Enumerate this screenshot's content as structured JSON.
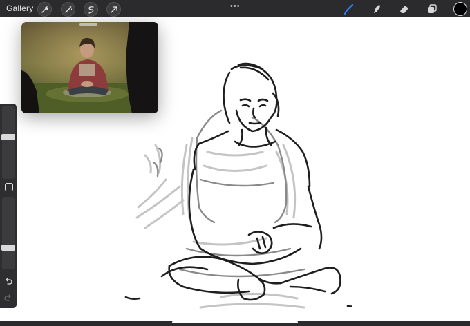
{
  "app": {
    "gallery_label": "Gallery"
  },
  "toolbar": {
    "left_tools": [
      "wrench-icon",
      "magic-wand-icon",
      "selection-icon",
      "transform-arrow-icon"
    ],
    "more": "•••",
    "right_tools": [
      "brush-icon",
      "smudge-icon",
      "eraser-icon",
      "layers-icon"
    ],
    "active_tool": "brush-icon",
    "accent_color": "#2f7cf6",
    "current_color": "#000000"
  },
  "sidebar": {
    "brush_size": 0.58,
    "opacity": 0.28,
    "modify_button": "square-icon",
    "undo": "undo-icon",
    "redo": "redo-icon"
  },
  "reference": {
    "image": "reference-photo-girl-sitting-on-grass"
  },
  "canvas": {
    "background": "#ffffff",
    "sketch": "pencil-sketch-girl-sitting-cross-legged"
  }
}
